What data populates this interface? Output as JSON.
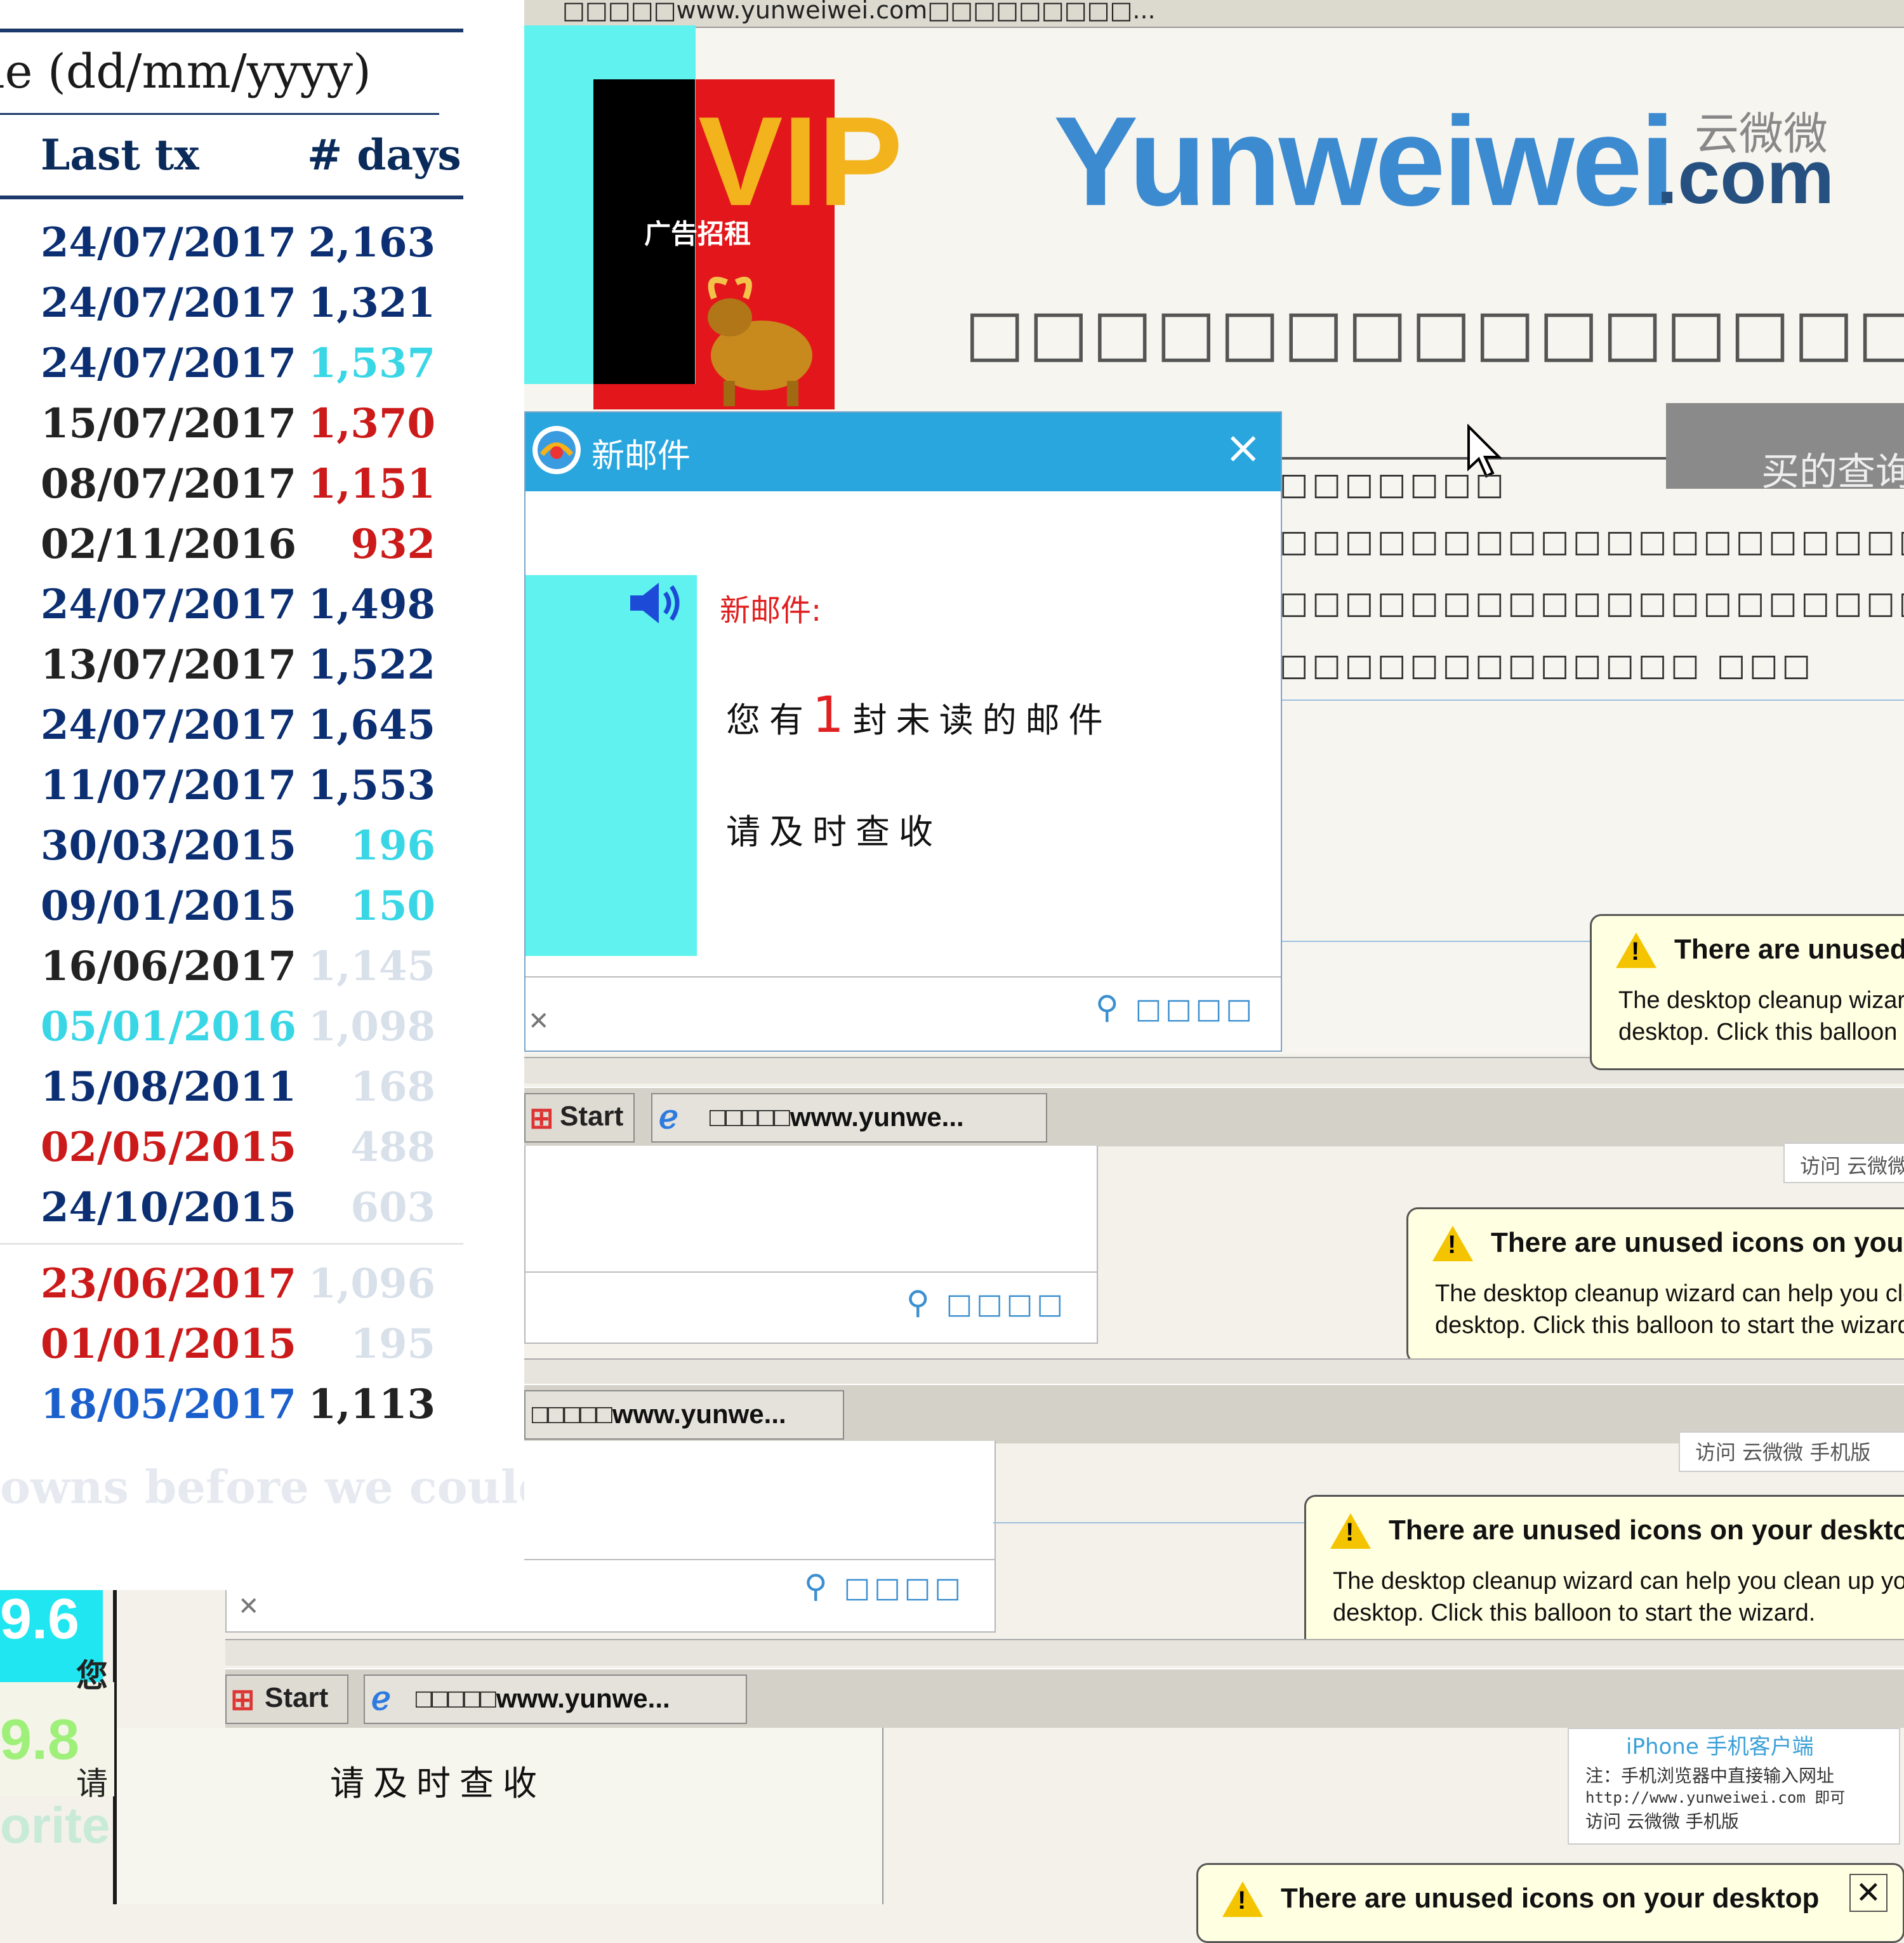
{
  "table": {
    "header": "ne (dd/mm/yyyy)",
    "col_last_tx": "Last tx",
    "col_days": "# days",
    "rows": [
      {
        "date": "24/07/2017",
        "days": "2,163"
      },
      {
        "date": "24/07/2017",
        "days": "1,321"
      },
      {
        "date": "24/07/2017",
        "days": "1,537"
      },
      {
        "date": "15/07/2017",
        "days": "1,370"
      },
      {
        "date": "08/07/2017",
        "days": "1,151"
      },
      {
        "date": "02/11/2016",
        "days": "932"
      },
      {
        "date": "24/07/2017",
        "days": "1,498"
      },
      {
        "date": "13/07/2017",
        "days": "1,522"
      },
      {
        "date": "24/07/2017",
        "days": "1,645"
      },
      {
        "date": "11/07/2017",
        "days": "1,553"
      },
      {
        "date": "30/03/2015",
        "days": "196"
      },
      {
        "date": "09/01/2015",
        "days": "150"
      },
      {
        "date": "16/06/2017",
        "days": "1,145"
      },
      {
        "date": "05/01/2016",
        "days": "1,098"
      },
      {
        "date": "15/08/2011",
        "days": "168"
      },
      {
        "date": "02/05/2015",
        "days": "488"
      },
      {
        "date": "24/10/2015",
        "days": "603"
      },
      {
        "date": "23/06/2017",
        "days": "1,096"
      },
      {
        "date": "01/01/2015",
        "days": "195"
      },
      {
        "date": "18/05/2017",
        "days": "1,113"
      }
    ],
    "footer_text": "owns before we could"
  },
  "left_fragments": {
    "num1": "9.6",
    "num2": "9.8",
    "word": "orite",
    "cn1": "您",
    "cn2": "请"
  },
  "browser": {
    "title": "□□□□□www.yunweiwei.com□□□□□□□□□...",
    "vip_text": "VIP",
    "vip_sub": "广告招租",
    "logo": "Yunweiwei",
    "logo_com": ".com",
    "logo_cn": "云微微",
    "boxes_row": "□□□□□□□□□□□□□□□□",
    "search_button": "买的查询",
    "line1": "□□□□□□□",
    "line2": "□□□□□□□□□□□□□□□□□□□□□□",
    "line3": "□□□□□□□□□□□□□□□□□□□□",
    "line4": "□□□□□□□□□□□□□ □□□"
  },
  "mail_popup": {
    "title": "新邮件",
    "label": "新邮件:",
    "msg_pre": "您有",
    "msg_count": "1",
    "msg_post": "封未读的邮件",
    "msg2": "请及时查收",
    "search": "□□□□"
  },
  "taskbar": {
    "start": "Start",
    "item": "□□□□□www.yunwe..."
  },
  "balloon": {
    "title": "There are unused icons on your desktop",
    "body1": "The desktop cleanup wizard can help you clean up your",
    "body2": "desktop. Click this balloon to start the wizard."
  },
  "ads": {
    "visit": "访问 云微微 手机版",
    "iphone": "iPhone 手机客户端",
    "note1": "注：手机浏览器中直接输入网址",
    "note2": "http://www.yunweiwei.com 即可",
    "note3": "访问 云微微 手机版"
  },
  "bottom_text": "请及时查收",
  "colors": {
    "popup_title": "#2aa6de",
    "taskbar": "#d4d1c8",
    "balloon": "#ffffe1",
    "navy_text": "#0b2f72",
    "red_text": "#cc1a1a"
  }
}
